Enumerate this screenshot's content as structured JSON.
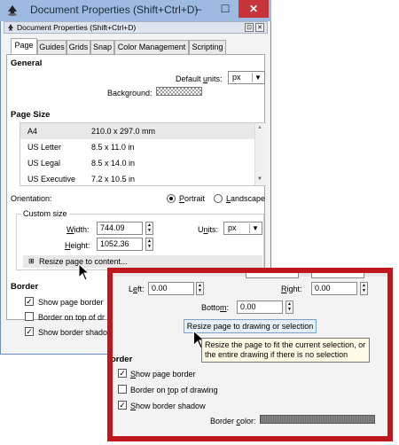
{
  "window": {
    "title": "Document Properties (Shift+Ctrl+D)",
    "minimize_glyph": "–",
    "maximize_glyph": "☐",
    "close_glyph": "✕"
  },
  "dock": {
    "title": "Document Properties (Shift+Ctrl+D)",
    "btn1": "⊡",
    "btn2": "✕"
  },
  "tabs": [
    {
      "label": "Page"
    },
    {
      "label": "Guides"
    },
    {
      "label": "Grids"
    },
    {
      "label": "Snap"
    },
    {
      "label": "Color Management"
    },
    {
      "label": "Scripting"
    }
  ],
  "general": {
    "header": "General",
    "default_units_label": "Default units:",
    "default_units_value": "px",
    "background_label": "Background:"
  },
  "page_size": {
    "header": "Page Size",
    "rows": [
      {
        "name": "A4",
        "size": "210.0 x 297.0 mm"
      },
      {
        "name": "US Letter",
        "size": "8.5 x 11.0 in"
      },
      {
        "name": "US Legal",
        "size": "8.5 x 14.0 in"
      },
      {
        "name": "US Executive",
        "size": "7.2 x 10.5 in"
      }
    ]
  },
  "orientation": {
    "label": "Orientation:",
    "portrait": "Portrait",
    "landscape": "Landscape"
  },
  "custom": {
    "label": "Custom size",
    "width_label": "Width:",
    "width_value": "744.09",
    "height_label": "Height:",
    "height_value": "1052.36",
    "units_label": "Units:",
    "units_value": "px",
    "expander": "⊞",
    "resize_label": "Resize page to content..."
  },
  "border": {
    "header": "Border",
    "show_page_border": "Show page border",
    "border_on_top_cut": "Border on top of dr",
    "show_border_shadow_cut": "Show border shado"
  },
  "zoom": {
    "left_label": "Left:",
    "left_value": "0.00",
    "right_label": "Right:",
    "right_value": "0.00",
    "bottom_label": "Bottom:",
    "bottom_value": "0.00",
    "resize_button": "Resize page to drawing or selection",
    "tooltip_line1": "Resize the page to fit the current selection, or",
    "tooltip_line2": "the entire drawing if there is no selection",
    "border_header_cut": "order",
    "show_page_border": "Show page border",
    "border_on_top": "Border on top of drawing",
    "show_border_shadow": "Show border shadow",
    "border_color_label": "Border color:"
  },
  "icons": {
    "app": "inkscape-icon",
    "cursor": "mouse-cursor-icon"
  }
}
